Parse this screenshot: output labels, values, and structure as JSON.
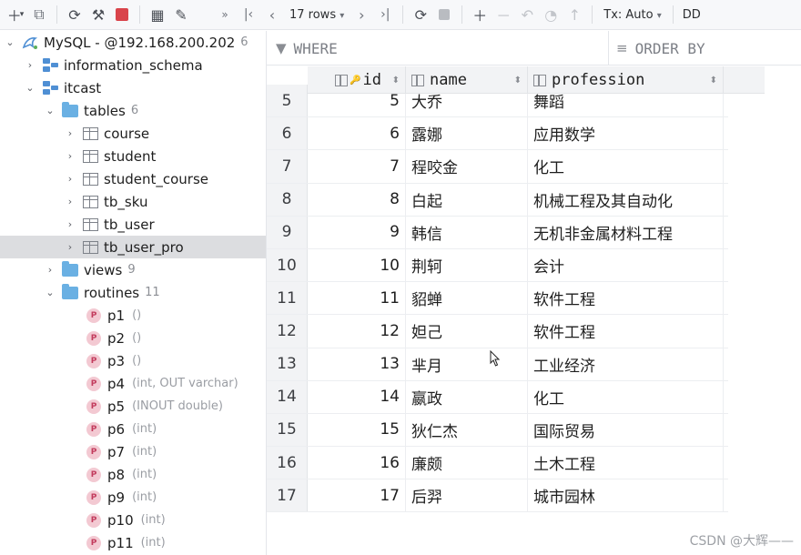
{
  "toolbar": {
    "rows_label": "17 rows",
    "tx_label": "Tx: Auto",
    "ddl_label": "DD"
  },
  "sidebar": {
    "connection": {
      "label": "MySQL - @192.168.200.202",
      "count": "6"
    },
    "schemas": [
      {
        "label": "information_schema"
      },
      {
        "label": "itcast"
      }
    ],
    "tables_folder": {
      "label": "tables",
      "count": "6"
    },
    "tables": [
      {
        "label": "course"
      },
      {
        "label": "student"
      },
      {
        "label": "student_course"
      },
      {
        "label": "tb_sku"
      },
      {
        "label": "tb_user"
      },
      {
        "label": "tb_user_pro"
      }
    ],
    "views_folder": {
      "label": "views",
      "count": "9"
    },
    "routines_folder": {
      "label": "routines",
      "count": "11"
    },
    "routines": [
      {
        "label": "p1",
        "params": "()"
      },
      {
        "label": "p2",
        "params": "()"
      },
      {
        "label": "p3",
        "params": "()"
      },
      {
        "label": "p4",
        "params": "(int, OUT varchar)"
      },
      {
        "label": "p5",
        "params": "(INOUT double)"
      },
      {
        "label": "p6",
        "params": "(int)"
      },
      {
        "label": "p7",
        "params": "(int)"
      },
      {
        "label": "p8",
        "params": "(int)"
      },
      {
        "label": "p9",
        "params": "(int)"
      },
      {
        "label": "p10",
        "params": "(int)"
      },
      {
        "label": "p11",
        "params": "(int)"
      }
    ],
    "routine_badge": "P"
  },
  "filters": {
    "where": "WHERE",
    "order_by": "ORDER BY"
  },
  "grid": {
    "columns": [
      "id",
      "name",
      "profession"
    ],
    "rows": [
      {
        "num": "5",
        "id": "5",
        "name": "大乔",
        "profession": "舞蹈"
      },
      {
        "num": "6",
        "id": "6",
        "name": "露娜",
        "profession": "应用数学"
      },
      {
        "num": "7",
        "id": "7",
        "name": "程咬金",
        "profession": "化工"
      },
      {
        "num": "8",
        "id": "8",
        "name": "白起",
        "profession": "机械工程及其自动化"
      },
      {
        "num": "9",
        "id": "9",
        "name": "韩信",
        "profession": "无机非金属材料工程"
      },
      {
        "num": "10",
        "id": "10",
        "name": "荆轲",
        "profession": "会计"
      },
      {
        "num": "11",
        "id": "11",
        "name": "貂蝉",
        "profession": "软件工程"
      },
      {
        "num": "12",
        "id": "12",
        "name": "妲己",
        "profession": "软件工程"
      },
      {
        "num": "13",
        "id": "13",
        "name": "芈月",
        "profession": "工业经济"
      },
      {
        "num": "14",
        "id": "14",
        "name": "嬴政",
        "profession": "化工"
      },
      {
        "num": "15",
        "id": "15",
        "name": "狄仁杰",
        "profession": "国际贸易"
      },
      {
        "num": "16",
        "id": "16",
        "name": "廉颇",
        "profession": "土木工程"
      },
      {
        "num": "17",
        "id": "17",
        "name": "后羿",
        "profession": "城市园林"
      }
    ]
  },
  "watermark": "CSDN @大辉——"
}
